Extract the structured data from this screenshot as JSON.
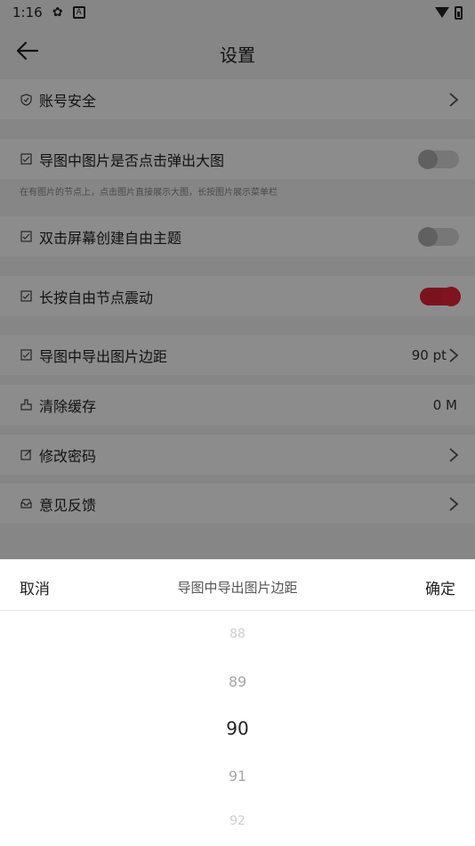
{
  "status_bar": {
    "time": "1:16"
  },
  "header": {
    "title": "设置",
    "back_icon": "arrow-left-icon"
  },
  "settings": {
    "account_security": {
      "label": "账号安全"
    },
    "map_image_popup": {
      "label": "导图中图片是否点击弹出大图",
      "enabled": false,
      "description": "在有图片的节点上，点击图片直接展示大图，长按图片展示菜单栏"
    },
    "double_tap_topic": {
      "label": "双击屏幕创建自由主题",
      "enabled": false
    },
    "long_press_vibrate": {
      "label": "长按自由节点震动",
      "enabled": true
    },
    "export_image_margin": {
      "label": "导图中导出图片边距",
      "value": "90 pt"
    },
    "clear_cache": {
      "label": "清除缓存",
      "value": "0 M"
    },
    "change_password": {
      "label": "修改密码"
    },
    "feedback": {
      "label": "意见反馈"
    }
  },
  "picker": {
    "cancel_label": "取消",
    "title": "导图中导出图片边距",
    "confirm_label": "确定",
    "options": [
      "88",
      "89",
      "90",
      "91",
      "92"
    ],
    "selected": "90"
  },
  "colors": {
    "accent": "#e0243a",
    "overlay": "rgba(0,0,0,0.45)"
  }
}
